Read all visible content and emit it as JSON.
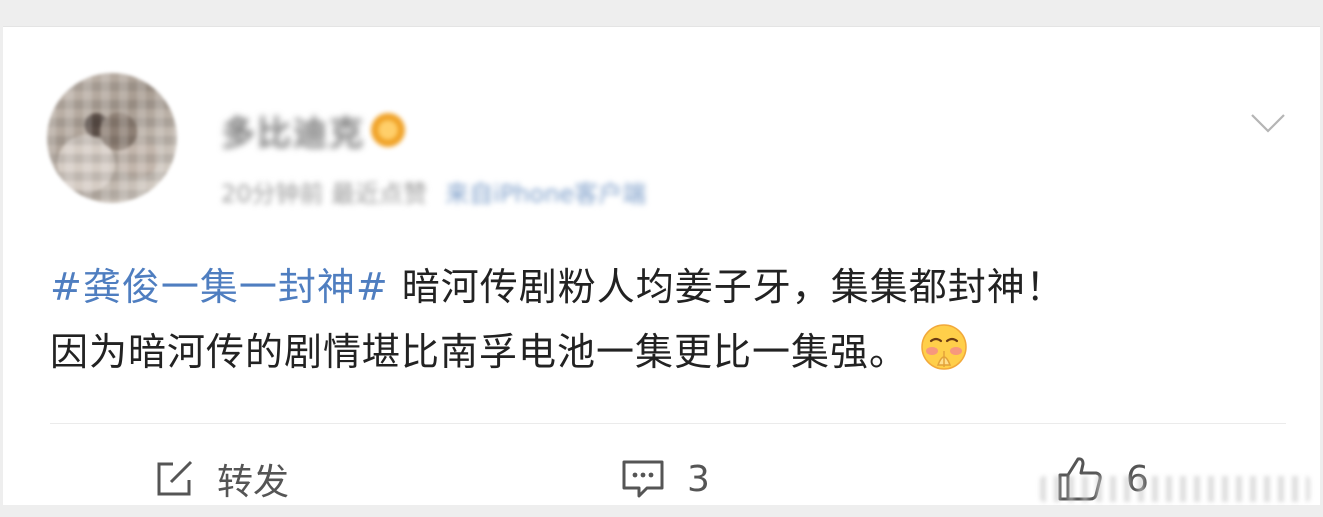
{
  "post": {
    "author": {
      "name": "多比迪克",
      "meta_time": "20分钟前 最近点赞",
      "meta_source": "来自iPhone客户端"
    },
    "hashtag": "#龚俊一集一封神#",
    "text_part1": " 暗河传剧粉人均姜子牙，集集都封神！",
    "text_part2": "因为暗河传的剧情堪比南孚电池一集更比一集强。",
    "emoji": "shy-pleading-face"
  },
  "actions": {
    "repost_label": "转发",
    "comment_count": "3",
    "like_count": "6"
  },
  "colors": {
    "hashtag": "#4f7ec0",
    "text": "#222222",
    "action": "#555555",
    "background": "#eeeeee",
    "card": "#ffffff"
  },
  "icons": [
    "chevron-down-icon",
    "share-icon",
    "comment-icon",
    "thumbs-up-icon",
    "emoji-icon"
  ]
}
